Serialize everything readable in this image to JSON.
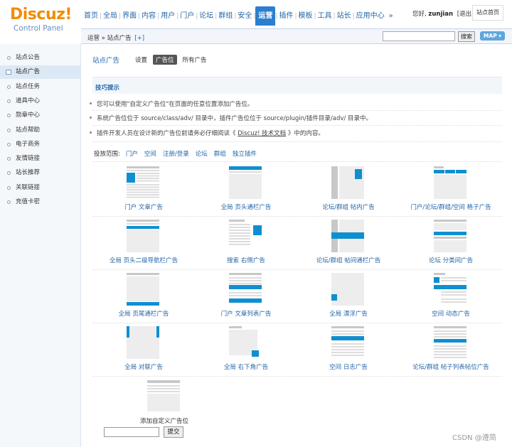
{
  "logo": {
    "text": "Discuz",
    "bang": "!",
    "subtitle": "Control Panel"
  },
  "topnav": [
    {
      "label": "首页",
      "active": false
    },
    {
      "label": "全局",
      "active": false
    },
    {
      "label": "界面",
      "active": false
    },
    {
      "label": "内容",
      "active": false
    },
    {
      "label": "用户",
      "active": false
    },
    {
      "label": "门户",
      "active": false
    },
    {
      "label": "论坛",
      "active": false
    },
    {
      "label": "群组",
      "active": false
    },
    {
      "label": "安全",
      "active": false
    },
    {
      "label": "运营",
      "active": true
    },
    {
      "label": "插件",
      "active": false
    },
    {
      "label": "模板",
      "active": false
    },
    {
      "label": "工具",
      "active": false
    },
    {
      "label": "站长",
      "active": false
    },
    {
      "label": "应用中心",
      "active": false
    }
  ],
  "topnav_more": "»",
  "userbar": {
    "greeting": "您好, ",
    "username": "zunjian",
    "logout": "[退出]",
    "site_home": "站点首页"
  },
  "subbar": {
    "crumb": "运营 » 站点广告",
    "plus": "[+]",
    "search_button": "搜索",
    "map_button": "MAP ▾"
  },
  "sidebar": [
    {
      "label": "站点公告",
      "active": false
    },
    {
      "label": "站点广告",
      "active": true
    },
    {
      "label": "站点任务",
      "active": false
    },
    {
      "label": "道具中心",
      "active": false
    },
    {
      "label": "勋章中心",
      "active": false
    },
    {
      "label": "站点帮助",
      "active": false
    },
    {
      "label": "电子商务",
      "active": false
    },
    {
      "label": "友情链接",
      "active": false
    },
    {
      "label": "站长推荐",
      "active": false
    },
    {
      "label": "关联链接",
      "active": false
    },
    {
      "label": "充值卡密",
      "active": false
    }
  ],
  "tabs": {
    "title": "站点广告",
    "items": [
      {
        "label": "设置",
        "current": false
      },
      {
        "label": "广告位",
        "current": true
      },
      {
        "label": "所有广告",
        "current": false
      }
    ]
  },
  "tips": {
    "title": "技巧提示",
    "line1": "您可以使用\"自定义广告位\"在页面的任意位置添加广告位。",
    "line2": "系统广告位位于 source/class/adv/ 目录中，插件广告位位于 source/plugin/插件目录/adv/ 目录中。",
    "line3_pre": "插件开发人员在设计新的广告位前请务必仔细阅读《 ",
    "line3_link": "Discuz! 技术文档",
    "line3_post": " 》中的内容。"
  },
  "scope": {
    "label": "投放范围:",
    "items": [
      "门户",
      "空间",
      "注册/登录",
      "论坛",
      "群组",
      "独立插件"
    ]
  },
  "ad_positions": [
    {
      "label": "门户 文章广告",
      "icon": "article-ad-icon"
    },
    {
      "label": "全局 页头通栏广告",
      "icon": "header-banner-ad-icon"
    },
    {
      "label": "论坛/群组 帖内广告",
      "icon": "thread-inner-ad-icon"
    },
    {
      "label": "门户/论坛/群组/空间 格子广告",
      "icon": "grid-ad-icon"
    },
    {
      "label": "全局 页头二级导航栏广告",
      "icon": "subnav-ad-icon"
    },
    {
      "label": "搜索 右侧广告",
      "icon": "search-right-ad-icon"
    },
    {
      "label": "论坛/群组 帖间通栏广告",
      "icon": "interthread-banner-ad-icon"
    },
    {
      "label": "论坛 分类间广告",
      "icon": "category-ad-icon"
    },
    {
      "label": "全局 页尾通栏广告",
      "icon": "footer-banner-ad-icon"
    },
    {
      "label": "门户 文章列表广告",
      "icon": "article-list-ad-icon"
    },
    {
      "label": "全局 漂浮广告",
      "icon": "float-ad-icon"
    },
    {
      "label": "空间 动态广告",
      "icon": "feed-ad-icon"
    },
    {
      "label": "全局 对联广告",
      "icon": "couplet-ad-icon"
    },
    {
      "label": "全局 右下角广告",
      "icon": "corner-ad-icon"
    },
    {
      "label": "空间 日志广告",
      "icon": "blog-ad-icon"
    },
    {
      "label": "论坛/群组 帖子列表帖位广告",
      "icon": "thread-list-ad-icon"
    }
  ],
  "custom_ad": {
    "label": "添加自定义广告位",
    "submit": "提交"
  },
  "watermark": "CSDN @遵简",
  "colors": {
    "accent": "#0F8FD0",
    "nav_active": "#2B7FCF",
    "placeholder": "#EDEDED",
    "placeholder_dark": "#C8C8C8"
  }
}
